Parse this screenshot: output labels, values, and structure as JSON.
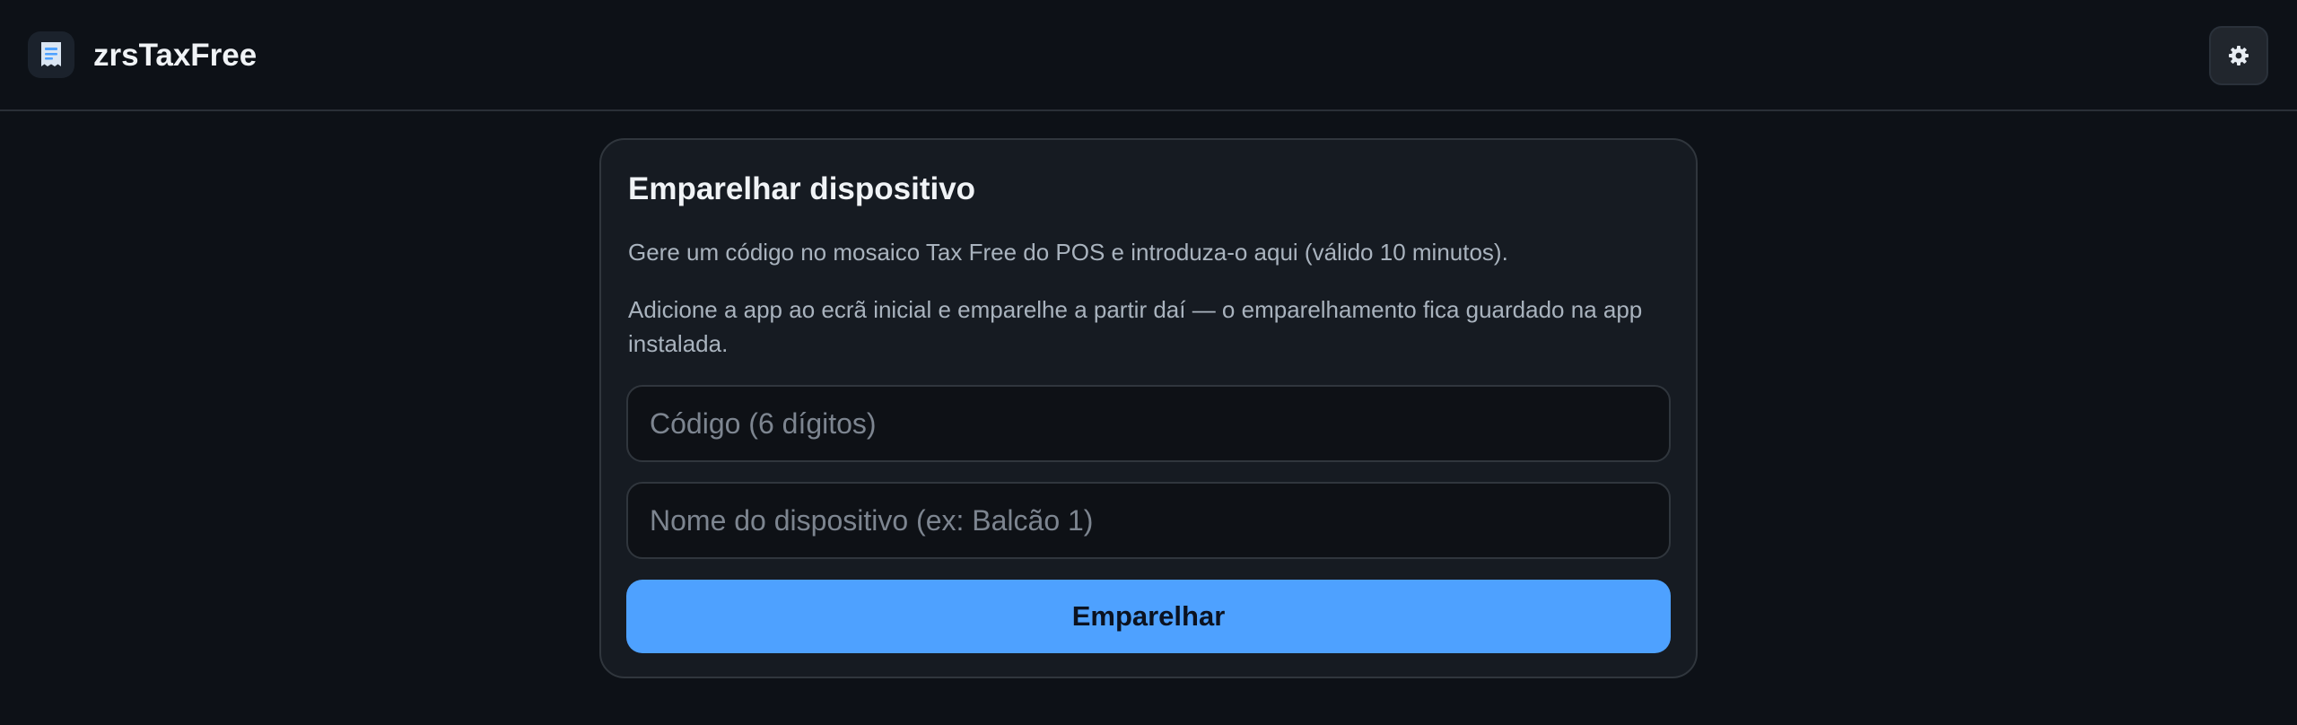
{
  "header": {
    "app_title": "zrsTaxFree",
    "logo_icon": "receipt-icon",
    "settings_icon": "gear-icon"
  },
  "pair_card": {
    "title": "Emparelhar dispositivo",
    "description": "Gere um código no mosaico Tax Free do POS e introduza-o aqui (válido 10 minutos).",
    "hint": "Adicione a app ao ecrã inicial e emparelhe a partir daí — o emparelhamento fica guardado na app instalada.",
    "code_field": {
      "value": "",
      "placeholder": "Código (6 dígitos)"
    },
    "name_field": {
      "value": "",
      "placeholder": "Nome do dispositivo (ex: Balcão 1)"
    },
    "submit_label": "Emparelhar"
  },
  "colors": {
    "background": "#0d1117",
    "card": "#161b22",
    "accent": "#4ea1ff"
  }
}
